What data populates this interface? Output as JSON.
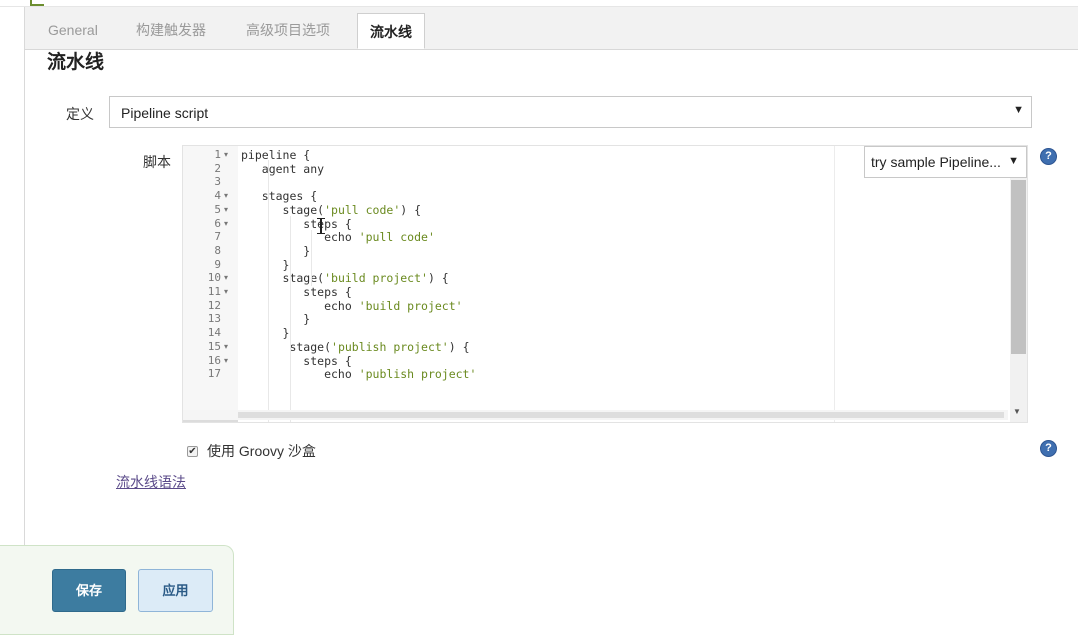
{
  "tabs": [
    {
      "label": "General"
    },
    {
      "label": "构建触发器"
    },
    {
      "label": "高级项目选项"
    },
    {
      "label": "流水线"
    }
  ],
  "section_title": "流水线",
  "definition": {
    "label": "定义",
    "value": "Pipeline script"
  },
  "script": {
    "label": "脚本",
    "sample_select": "try sample Pipeline...",
    "lines": [
      {
        "num": "1",
        "text": "pipeline {",
        "fold": true
      },
      {
        "num": "2",
        "text": "   agent any",
        "fold": false
      },
      {
        "num": "3",
        "text": "",
        "fold": false
      },
      {
        "num": "4",
        "text": "   stages {",
        "fold": true
      },
      {
        "num": "5",
        "text": "      stage('pull code') {",
        "fold": true
      },
      {
        "num": "6",
        "text": "         steps {",
        "fold": true
      },
      {
        "num": "7",
        "text": "            echo 'pull code'",
        "fold": false
      },
      {
        "num": "8",
        "text": "         }",
        "fold": false
      },
      {
        "num": "9",
        "text": "      }",
        "fold": false
      },
      {
        "num": "10",
        "text": "      stage('build project') {",
        "fold": true
      },
      {
        "num": "11",
        "text": "         steps {",
        "fold": true
      },
      {
        "num": "12",
        "text": "            echo 'build project'",
        "fold": false
      },
      {
        "num": "13",
        "text": "         }",
        "fold": false
      },
      {
        "num": "14",
        "text": "      }",
        "fold": false
      },
      {
        "num": "15",
        "text": "       stage('publish project') {",
        "fold": true
      },
      {
        "num": "16",
        "text": "         steps {",
        "fold": true
      },
      {
        "num": "17",
        "text": "            echo 'publish project'",
        "fold": false
      }
    ]
  },
  "sandbox": {
    "label": "使用 Groovy 沙盒",
    "checked": true,
    "check_glyph": "✔"
  },
  "syntax_link": "流水线语法",
  "buttons": {
    "save": "保存",
    "apply": "应用"
  },
  "icons": {
    "help": "?",
    "dropdown_caret": "▼",
    "fold_marker": "▾"
  },
  "colors": {
    "save_button": "#3d7ca0",
    "apply_button": "#dcebf7",
    "help_icon": "#3f6fb0",
    "code_string": "#6a8a1f"
  }
}
